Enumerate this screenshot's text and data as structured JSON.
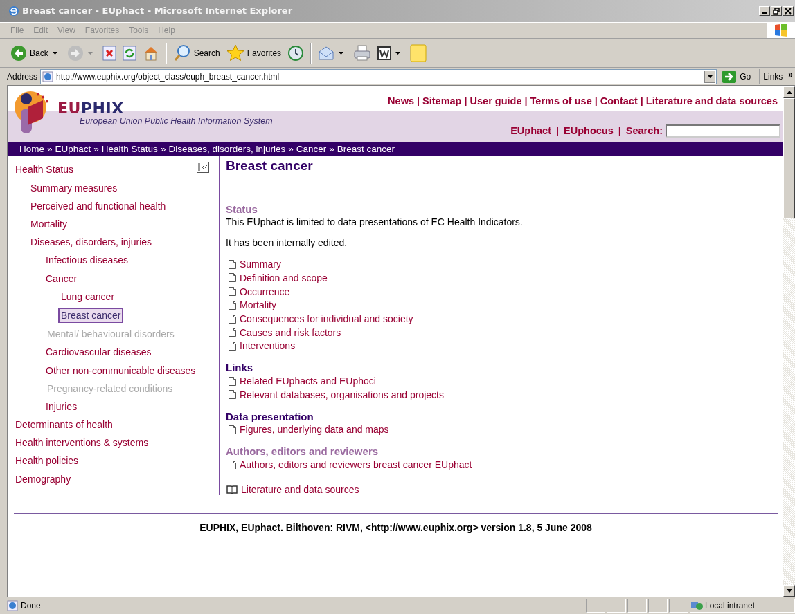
{
  "window": {
    "title": "Breast cancer - EUphact - Microsoft Internet Explorer"
  },
  "menu": [
    "File",
    "Edit",
    "View",
    "Favorites",
    "Tools",
    "Help"
  ],
  "toolbar": [
    {
      "kind": "back",
      "label": "Back",
      "dropdown": true
    },
    {
      "kind": "forward",
      "dropdown": true
    },
    {
      "kind": "stop",
      "dropdown": false
    },
    {
      "kind": "refresh",
      "dropdown": false
    },
    {
      "kind": "home",
      "dropdown": false
    },
    {
      "kind": "search",
      "label": "Search",
      "dropdown": false
    },
    {
      "kind": "favorites",
      "label": "Favorites",
      "dropdown": false
    },
    {
      "kind": "history",
      "dropdown": false
    },
    {
      "kind": "mail",
      "dropdown": true
    },
    {
      "kind": "print",
      "dropdown": false
    },
    {
      "kind": "word",
      "dropdown": true
    },
    {
      "kind": "note",
      "dropdown": false
    }
  ],
  "address": {
    "label": "Address",
    "url": "http://www.euphix.org/object_class/euph_breast_cancer.html",
    "go": "Go",
    "links": "Links",
    "more": "»"
  },
  "site": {
    "brand_first": "EU",
    "brand_rest": "PHIX",
    "tagline": "European Union Public Health Information System",
    "separator": "|",
    "top_links": [
      "News",
      "Sitemap",
      "User guide",
      "Terms of use",
      "Contact",
      "Literature and data sources"
    ],
    "sub_links": [
      "EUphact",
      "EUphocus"
    ],
    "search_label": "Search:"
  },
  "breadcrumb": {
    "separator": "»",
    "items": [
      "Home",
      "EUphact",
      "Health Status",
      "Diseases, disorders, injuries",
      "Cancer",
      "Breast cancer"
    ]
  },
  "nav": [
    {
      "label": "Health Status",
      "selected": false,
      "disabled": false,
      "children": [
        {
          "label": "Summary measures",
          "selected": false,
          "disabled": false
        },
        {
          "label": "Perceived and functional health",
          "selected": false,
          "disabled": false
        },
        {
          "label": "Mortality",
          "selected": false,
          "disabled": false
        },
        {
          "label": "Diseases, disorders, injuries",
          "selected": false,
          "disabled": false,
          "children": [
            {
              "label": "Infectious diseases",
              "selected": false,
              "disabled": false
            },
            {
              "label": "Cancer",
              "selected": false,
              "disabled": false,
              "children": [
                {
                  "label": "Lung cancer",
                  "selected": false,
                  "disabled": false
                },
                {
                  "label": "Breast cancer",
                  "selected": true,
                  "disabled": false
                }
              ]
            },
            {
              "label": "Mental/ behavioural disorders",
              "selected": false,
              "disabled": true
            },
            {
              "label": "Cardiovascular diseases",
              "selected": false,
              "disabled": false
            },
            {
              "label": "Other non-communicable diseases",
              "selected": false,
              "disabled": false
            },
            {
              "label": "Pregnancy-related conditions",
              "selected": false,
              "disabled": true
            },
            {
              "label": "Injuries",
              "selected": false,
              "disabled": false
            }
          ]
        }
      ]
    },
    {
      "label": "Determinants of health",
      "selected": false,
      "disabled": false
    },
    {
      "label": "Health interventions & systems",
      "selected": false,
      "disabled": false
    },
    {
      "label": "Health policies",
      "selected": false,
      "disabled": false
    },
    {
      "label": "Demography",
      "selected": false,
      "disabled": false
    }
  ],
  "page": {
    "title": "Breast cancer",
    "sections": [
      {
        "heading": "Status",
        "muted": true,
        "paragraphs": [
          "This EUphact is limited to data presentations of EC Health Indicators.",
          "It has been internally edited."
        ],
        "links": [
          "Summary",
          "Definition and scope",
          "Occurrence",
          "Mortality",
          "Consequences for individual and society",
          "Causes and risk factors",
          "Interventions"
        ]
      },
      {
        "heading": "Links",
        "muted": false,
        "links": [
          "Related EUphacts and EUphoci",
          "Relevant databases, organisations and projects"
        ]
      },
      {
        "heading": "Data presentation",
        "muted": false,
        "links": [
          "Figures, underlying data and maps"
        ]
      },
      {
        "heading": "Authors, editors and reviewers",
        "muted": true,
        "links": [
          "Authors, editors and reviewers breast cancer EUphact"
        ]
      }
    ],
    "literature_link": "Literature and data sources"
  },
  "footer": "EUPHIX, EUphact. Bilthoven: RIVM, <http://www.euphix.org> version 1.8, 5 June 2008",
  "status_bar": {
    "text": "Done",
    "zone": "Local intranet"
  }
}
